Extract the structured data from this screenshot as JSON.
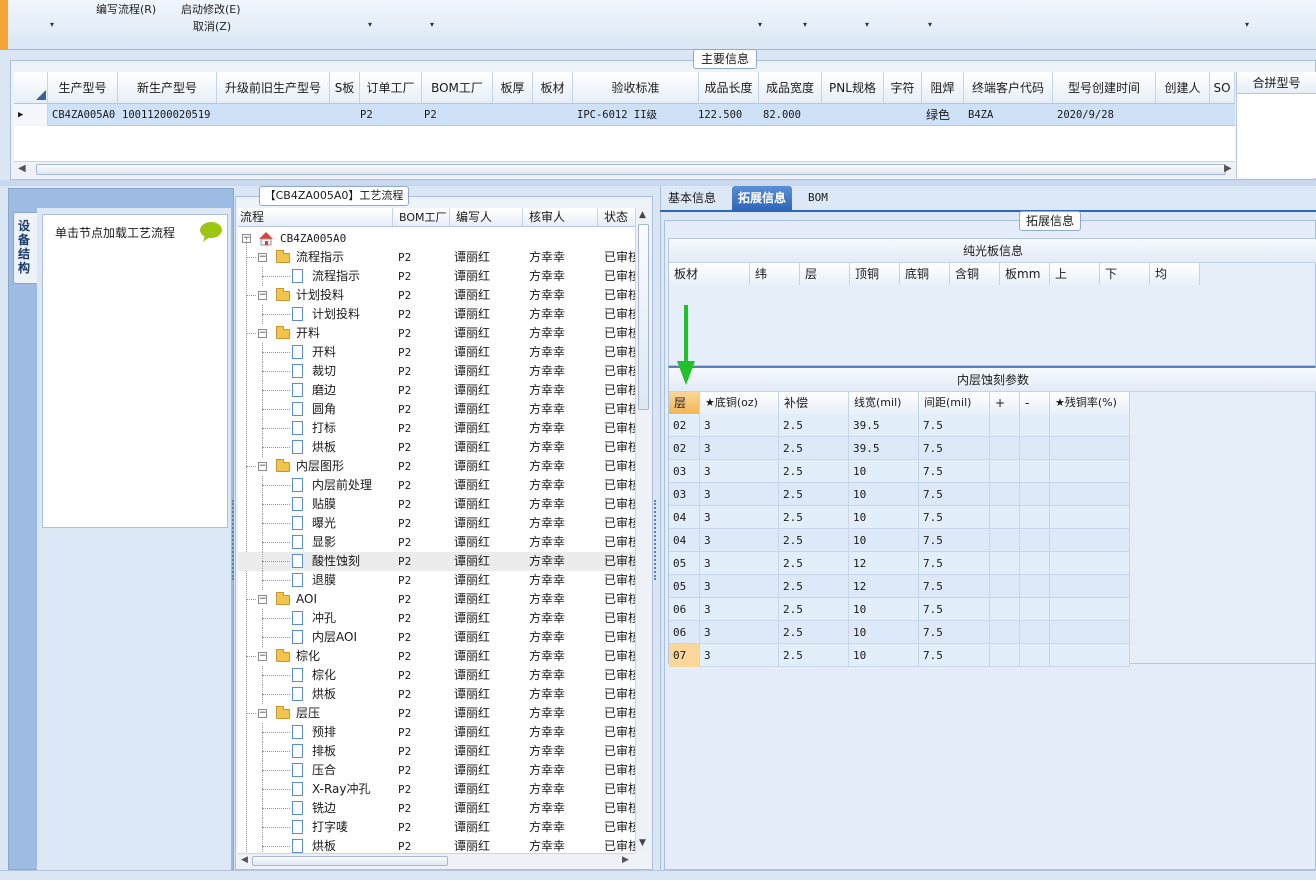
{
  "ribbon": {
    "edit_flow": "编写流程(R)",
    "start_modify": "启动修改(E)",
    "cancel": "取消(Z)"
  },
  "main_info": {
    "title": "主要信息",
    "columns": [
      "生产型号",
      "新生产型号",
      "升级前旧生产型号",
      "S板",
      "订单工厂",
      "BOM工厂",
      "板厚",
      "板材",
      "验收标准",
      "成品长度",
      "成品宽度",
      "PNL规格",
      "字符",
      "阻焊",
      "终端客户代码",
      "型号创建时间",
      "创建人",
      "SO"
    ],
    "row": [
      "CB4ZA005A0",
      "10011200020519",
      "",
      "",
      "P2",
      "P2",
      "",
      "",
      "IPC-6012 II级",
      "122.500",
      "82.000",
      "",
      "",
      "绿色",
      "B4ZA",
      "2020/9/28",
      "",
      ""
    ],
    "merge_header": "合拼型号"
  },
  "side": {
    "vertical_tab": "设备结构",
    "hint": "单击节点加载工艺流程"
  },
  "flow": {
    "title": "【CB4ZA005A0】工艺流程",
    "columns": [
      "流程",
      "BOM工厂",
      "编写人",
      "核审人",
      "状态"
    ],
    "root": "CB4ZA005A0",
    "rows": [
      {
        "name": "流程指示",
        "level": 1,
        "factory": "P2",
        "writer": "谭丽红",
        "reviewer": "方幸幸",
        "status": "已审核"
      },
      {
        "name": "流程指示",
        "level": 2,
        "factory": "P2",
        "writer": "谭丽红",
        "reviewer": "方幸幸",
        "status": "已审核"
      },
      {
        "name": "计划投料",
        "level": 1,
        "factory": "P2",
        "writer": "谭丽红",
        "reviewer": "方幸幸",
        "status": "已审核"
      },
      {
        "name": "计划投料",
        "level": 2,
        "factory": "P2",
        "writer": "谭丽红",
        "reviewer": "方幸幸",
        "status": "已审核"
      },
      {
        "name": "开料",
        "level": 1,
        "factory": "P2",
        "writer": "谭丽红",
        "reviewer": "方幸幸",
        "status": "已审核"
      },
      {
        "name": "开料",
        "level": 2,
        "factory": "P2",
        "writer": "谭丽红",
        "reviewer": "方幸幸",
        "status": "已审核"
      },
      {
        "name": "裁切",
        "level": 2,
        "factory": "P2",
        "writer": "谭丽红",
        "reviewer": "方幸幸",
        "status": "已审核"
      },
      {
        "name": "磨边",
        "level": 2,
        "factory": "P2",
        "writer": "谭丽红",
        "reviewer": "方幸幸",
        "status": "已审核"
      },
      {
        "name": "圆角",
        "level": 2,
        "factory": "P2",
        "writer": "谭丽红",
        "reviewer": "方幸幸",
        "status": "已审核"
      },
      {
        "name": "打标",
        "level": 2,
        "factory": "P2",
        "writer": "谭丽红",
        "reviewer": "方幸幸",
        "status": "已审核"
      },
      {
        "name": "烘板",
        "level": 2,
        "factory": "P2",
        "writer": "谭丽红",
        "reviewer": "方幸幸",
        "status": "已审核"
      },
      {
        "name": "内层图形",
        "level": 1,
        "factory": "P2",
        "writer": "谭丽红",
        "reviewer": "方幸幸",
        "status": "已审核"
      },
      {
        "name": "内层前处理",
        "level": 2,
        "factory": "P2",
        "writer": "谭丽红",
        "reviewer": "方幸幸",
        "status": "已审核"
      },
      {
        "name": "贴膜",
        "level": 2,
        "factory": "P2",
        "writer": "谭丽红",
        "reviewer": "方幸幸",
        "status": "已审核"
      },
      {
        "name": "曝光",
        "level": 2,
        "factory": "P2",
        "writer": "谭丽红",
        "reviewer": "方幸幸",
        "status": "已审核"
      },
      {
        "name": "显影",
        "level": 2,
        "factory": "P2",
        "writer": "谭丽红",
        "reviewer": "方幸幸",
        "status": "已审核"
      },
      {
        "name": "酸性蚀刻",
        "level": 2,
        "factory": "P2",
        "writer": "谭丽红",
        "reviewer": "方幸幸",
        "status": "已审核",
        "selected": true
      },
      {
        "name": "退膜",
        "level": 2,
        "factory": "P2",
        "writer": "谭丽红",
        "reviewer": "方幸幸",
        "status": "已审核"
      },
      {
        "name": "AOI",
        "level": 1,
        "factory": "P2",
        "writer": "谭丽红",
        "reviewer": "方幸幸",
        "status": "已审核"
      },
      {
        "name": "冲孔",
        "level": 2,
        "factory": "P2",
        "writer": "谭丽红",
        "reviewer": "方幸幸",
        "status": "已审核"
      },
      {
        "name": "内层AOI",
        "level": 2,
        "factory": "P2",
        "writer": "谭丽红",
        "reviewer": "方幸幸",
        "status": "已审核"
      },
      {
        "name": "棕化",
        "level": 1,
        "factory": "P2",
        "writer": "谭丽红",
        "reviewer": "方幸幸",
        "status": "已审核"
      },
      {
        "name": "棕化",
        "level": 2,
        "factory": "P2",
        "writer": "谭丽红",
        "reviewer": "方幸幸",
        "status": "已审核"
      },
      {
        "name": "烘板",
        "level": 2,
        "factory": "P2",
        "writer": "谭丽红",
        "reviewer": "方幸幸",
        "status": "已审核"
      },
      {
        "name": "层压",
        "level": 1,
        "factory": "P2",
        "writer": "谭丽红",
        "reviewer": "方幸幸",
        "status": "已审核"
      },
      {
        "name": "预排",
        "level": 2,
        "factory": "P2",
        "writer": "谭丽红",
        "reviewer": "方幸幸",
        "status": "已审核"
      },
      {
        "name": "排板",
        "level": 2,
        "factory": "P2",
        "writer": "谭丽红",
        "reviewer": "方幸幸",
        "status": "已审核"
      },
      {
        "name": "压合",
        "level": 2,
        "factory": "P2",
        "writer": "谭丽红",
        "reviewer": "方幸幸",
        "status": "已审核"
      },
      {
        "name": "X-Ray冲孔",
        "level": 2,
        "factory": "P2",
        "writer": "谭丽红",
        "reviewer": "方幸幸",
        "status": "已审核"
      },
      {
        "name": "铣边",
        "level": 2,
        "factory": "P2",
        "writer": "谭丽红",
        "reviewer": "方幸幸",
        "status": "已审核"
      },
      {
        "name": "打字唛",
        "level": 2,
        "factory": "P2",
        "writer": "谭丽红",
        "reviewer": "方幸幸",
        "status": "已审核"
      },
      {
        "name": "烘板",
        "level": 2,
        "factory": "P2",
        "writer": "谭丽红",
        "reviewer": "方幸幸",
        "status": "已审核"
      }
    ]
  },
  "tabs": [
    "基本信息",
    "拓展信息",
    "BOM"
  ],
  "ext_info": {
    "title": "拓展信息",
    "bare_board": {
      "title": "纯光板信息",
      "columns": [
        "板材",
        "纬",
        "层",
        "顶铜",
        "底铜",
        "含铜",
        "板mm",
        "上",
        "下",
        "均"
      ]
    },
    "inner_etch": {
      "title": "内层蚀刻参数",
      "columns": [
        "层",
        "★底铜(oz)",
        "补偿",
        "线宽(mil)",
        "间距(mil)",
        "+",
        "-",
        "★残铜率(%)"
      ],
      "rows": [
        [
          "02",
          "3",
          "2.5",
          "39.5",
          "7.5",
          "",
          "",
          ""
        ],
        [
          "02",
          "3",
          "2.5",
          "39.5",
          "7.5",
          "",
          "",
          ""
        ],
        [
          "03",
          "3",
          "2.5",
          "10",
          "7.5",
          "",
          "",
          ""
        ],
        [
          "03",
          "3",
          "2.5",
          "10",
          "7.5",
          "",
          "",
          ""
        ],
        [
          "04",
          "3",
          "2.5",
          "10",
          "7.5",
          "",
          "",
          ""
        ],
        [
          "04",
          "3",
          "2.5",
          "10",
          "7.5",
          "",
          "",
          ""
        ],
        [
          "05",
          "3",
          "2.5",
          "12",
          "7.5",
          "",
          "",
          ""
        ],
        [
          "05",
          "3",
          "2.5",
          "12",
          "7.5",
          "",
          "",
          ""
        ],
        [
          "06",
          "3",
          "2.5",
          "10",
          "7.5",
          "",
          "",
          ""
        ],
        [
          "06",
          "3",
          "2.5",
          "10",
          "7.5",
          "",
          "",
          ""
        ],
        [
          "07",
          "3",
          "2.5",
          "10",
          "7.5",
          "",
          "",
          ""
        ]
      ]
    }
  },
  "colors": {
    "accent_tab": "#2f66b8",
    "annotation_arrow": "#22c02a",
    "row_highlight": "#cfe1f7"
  }
}
